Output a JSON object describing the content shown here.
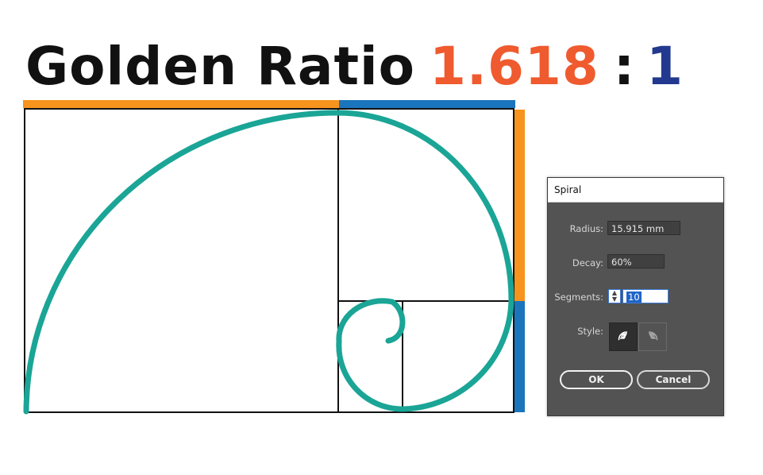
{
  "title": {
    "main": "Golden Ratio",
    "ratio": "1.618",
    "colon": ":",
    "one": "1"
  },
  "colors": {
    "orange": "#f7941d",
    "blue": "#1b75bc",
    "spiral": "#1aa596",
    "ratio_text": "#ef5a2f",
    "one_text": "#23398f"
  },
  "dialog": {
    "title": "Spiral",
    "radius_label": "Radius:",
    "radius_value": "15.915 mm",
    "decay_label": "Decay:",
    "decay_value": "60%",
    "segments_label": "Segments:",
    "segments_value": "10",
    "style_label": "Style:",
    "style_options": [
      "clockwise-spiral-icon",
      "counterclockwise-spiral-icon"
    ],
    "ok_label": "OK",
    "cancel_label": "Cancel"
  }
}
